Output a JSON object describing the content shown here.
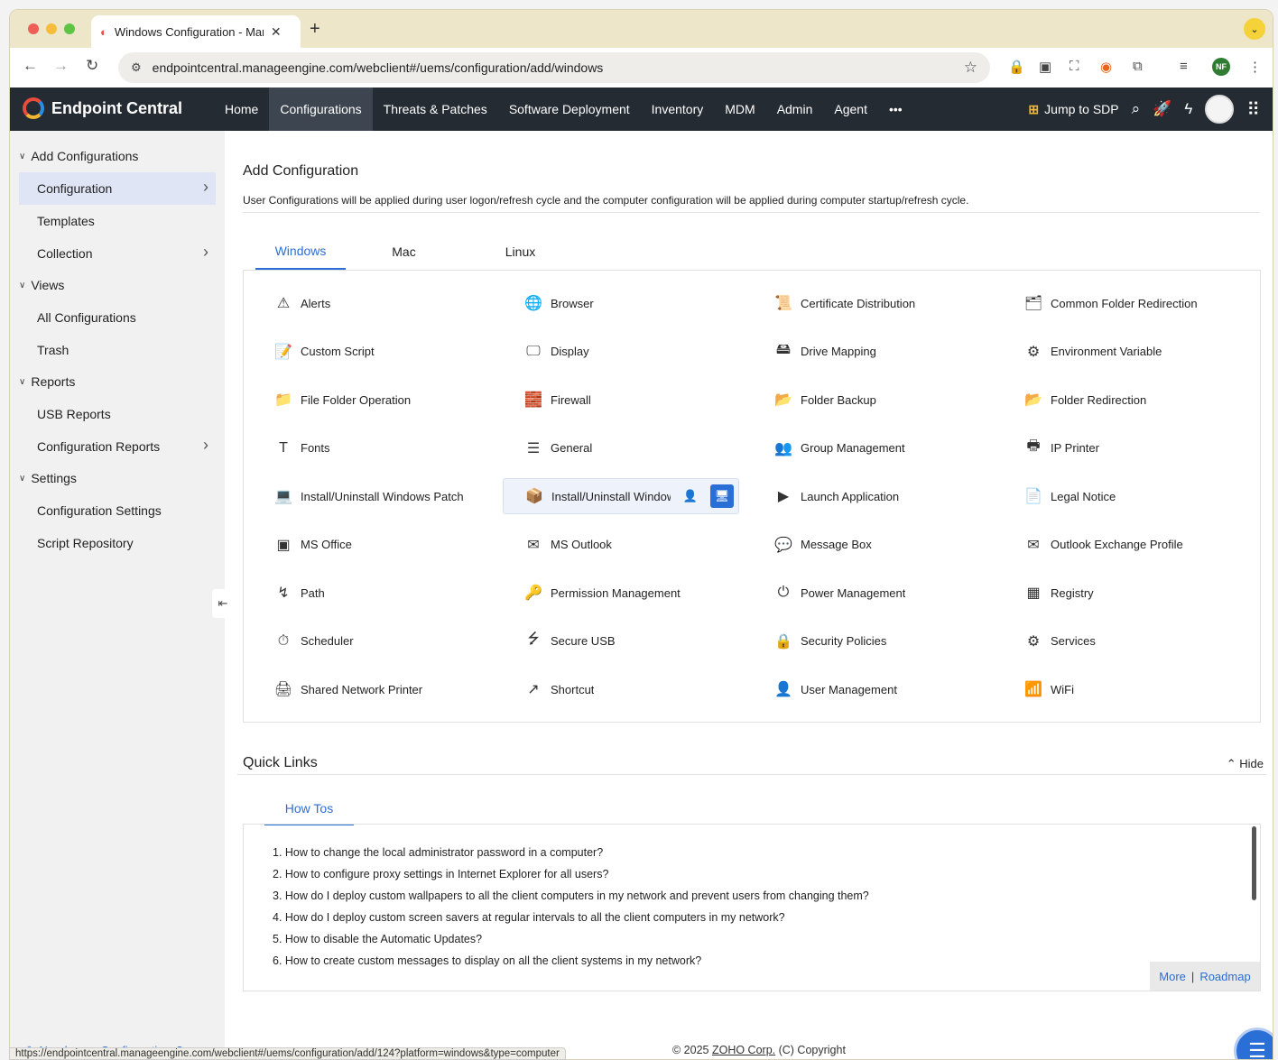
{
  "browser": {
    "tab_title": "Windows Configuration - ManageEngine",
    "url": "endpointcentral.manageengine.com/webclient#/uems/configuration/add/windows",
    "status_url": "https://endpointcentral.manageengine.com/webclient#/uems/configuration/add/124?platform=windows&type=computer",
    "profile_initials": "NF",
    "badge_count": "0"
  },
  "app": {
    "name": "Endpoint Central",
    "nav": [
      "Home",
      "Configurations",
      "Threats & Patches",
      "Software Deployment",
      "Inventory",
      "MDM",
      "Admin",
      "Agent",
      "•••"
    ],
    "active_nav": "Configurations",
    "jump_label": "Jump to SDP"
  },
  "sidebar": {
    "groups": [
      {
        "label": "Add Configurations",
        "items": [
          {
            "label": "Configuration",
            "arrow": true,
            "active": true
          },
          {
            "label": "Templates",
            "arrow": false
          },
          {
            "label": "Collection",
            "arrow": true
          }
        ]
      },
      {
        "label": "Views",
        "items": [
          {
            "label": "All Configurations",
            "arrow": false
          },
          {
            "label": "Trash",
            "arrow": false
          }
        ]
      },
      {
        "label": "Reports",
        "items": [
          {
            "label": "USB Reports",
            "arrow": false
          },
          {
            "label": "Configuration Reports",
            "arrow": true
          }
        ]
      },
      {
        "label": "Settings",
        "items": [
          {
            "label": "Configuration Settings",
            "arrow": false
          },
          {
            "label": "Script Repository",
            "arrow": false
          }
        ]
      }
    ],
    "need_more": "Need more Configurations?"
  },
  "main": {
    "title": "Add Configuration",
    "description": "User Configurations will be applied during user logon/refresh cycle and the computer configuration will be applied during computer startup/refresh cycle.",
    "os_tabs": [
      "Windows",
      "Mac",
      "Linux"
    ],
    "configs": [
      {
        "label": "Alerts",
        "icon": "alert-icon",
        "glyph": "⚠"
      },
      {
        "label": "Browser",
        "icon": "globe-icon",
        "glyph": "🌐"
      },
      {
        "label": "Certificate Distribution",
        "icon": "certificate-icon",
        "glyph": "📜"
      },
      {
        "label": "Common Folder Redirection",
        "icon": "folder-star-icon",
        "glyph": "🗂"
      },
      {
        "label": "Custom Script",
        "icon": "script-icon",
        "glyph": "📝"
      },
      {
        "label": "Display",
        "icon": "monitor-icon",
        "glyph": "🖵"
      },
      {
        "label": "Drive Mapping",
        "icon": "drive-icon",
        "glyph": "🖴"
      },
      {
        "label": "Environment Variable",
        "icon": "gear-doc-icon",
        "glyph": "⚙"
      },
      {
        "label": "File Folder Operation",
        "icon": "folder-gear-icon",
        "glyph": "📁"
      },
      {
        "label": "Firewall",
        "icon": "firewall-icon",
        "glyph": "🧱"
      },
      {
        "label": "Folder Backup",
        "icon": "folder-upload-icon",
        "glyph": "📂"
      },
      {
        "label": "Folder Redirection",
        "icon": "folder-arrow-icon",
        "glyph": "📂"
      },
      {
        "label": "Fonts",
        "icon": "font-icon",
        "glyph": "T"
      },
      {
        "label": "General",
        "icon": "document-icon",
        "glyph": "☰"
      },
      {
        "label": "Group Management",
        "icon": "group-icon",
        "glyph": "👥"
      },
      {
        "label": "IP Printer",
        "icon": "printer-icon",
        "glyph": "🖶"
      },
      {
        "label": "Install/Uninstall Windows Patch",
        "icon": "patch-icon",
        "glyph": "💻"
      },
      {
        "label": "Install/Uninstall Windows Features",
        "icon": "package-icon",
        "glyph": "📦"
      },
      {
        "label": "Launch Application",
        "icon": "terminal-icon",
        "glyph": "▶"
      },
      {
        "label": "Legal Notice",
        "icon": "legal-doc-icon",
        "glyph": "📄"
      },
      {
        "label": "MS Office",
        "icon": "office-icon",
        "glyph": "▣"
      },
      {
        "label": "MS Outlook",
        "icon": "outlook-icon",
        "glyph": "✉"
      },
      {
        "label": "Message Box",
        "icon": "message-icon",
        "glyph": "💬"
      },
      {
        "label": "Outlook Exchange Profile",
        "icon": "mail-icon",
        "glyph": "✉"
      },
      {
        "label": "Path",
        "icon": "path-icon",
        "glyph": "↯"
      },
      {
        "label": "Permission Management",
        "icon": "permission-icon",
        "glyph": "🔑"
      },
      {
        "label": "Power Management",
        "icon": "power-icon",
        "glyph": "⏻"
      },
      {
        "label": "Registry",
        "icon": "registry-icon",
        "glyph": "▦"
      },
      {
        "label": "Scheduler",
        "icon": "timer-icon",
        "glyph": "⏱"
      },
      {
        "label": "Secure USB",
        "icon": "usb-icon",
        "glyph": "⭍"
      },
      {
        "label": "Security Policies",
        "icon": "lock-icon",
        "glyph": "🔒"
      },
      {
        "label": "Services",
        "icon": "services-icon",
        "glyph": "⚙"
      },
      {
        "label": "Shared Network Printer",
        "icon": "network-printer-icon",
        "glyph": "🖨"
      },
      {
        "label": "Shortcut",
        "icon": "shortcut-icon",
        "glyph": "↗"
      },
      {
        "label": "User Management",
        "icon": "user-icon",
        "glyph": "👤"
      },
      {
        "label": "WiFi",
        "icon": "wifi-icon",
        "glyph": "📶"
      }
    ],
    "hovered_config": "Install/Uninstall Windows Features",
    "quick_links_title": "Quick Links",
    "hide_label": "Hide",
    "quick_tab": "How Tos",
    "howtos": [
      "1. How to change the local administrator password in a computer?",
      "2. How to configure proxy settings in Internet Explorer for all users?",
      "3. How do I deploy custom wallpapers to all the client computers in my network and prevent users from changing them?",
      "4. How do I deploy custom screen savers at regular intervals to all the client computers in my network?",
      "5. How to disable the Automatic Updates?",
      "6. How to create custom messages to display on all the client systems in my network?"
    ],
    "more_label": "More",
    "roadmap_label": "Roadmap",
    "copyright_prefix": "© 2025 ",
    "copyright_link": "ZOHO Corp.",
    "copyright_suffix": " (C) Copyright"
  }
}
